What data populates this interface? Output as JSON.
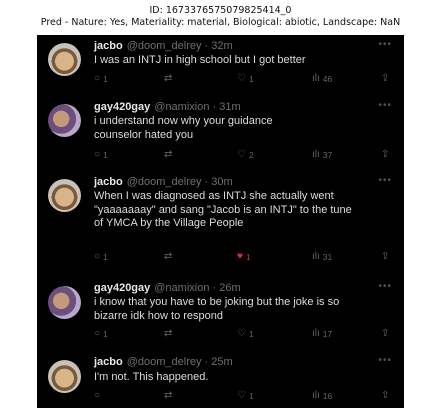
{
  "caption": {
    "line1": "ID: 1673376575079825414_0",
    "line2": "Pred - Nature: Yes, Materiality: material, Biological: abiotic, Landscape: NaN"
  },
  "tweets": [
    {
      "name": "jacbo",
      "handle": "@doom_delrey · 32m",
      "text": "I was an INTJ in high school but I got better",
      "reply": "1",
      "retweet": "",
      "like": "1",
      "views": "46"
    },
    {
      "name": "gay420gay",
      "handle": "@namixion · 31m",
      "text": "i understand now why your guidance counselor hated you",
      "reply": "1",
      "retweet": "",
      "like": "2",
      "views": "37"
    },
    {
      "name": "jacbo",
      "handle": "@doom_delrey · 30m",
      "text": "When I was diagnosed as INTJ she actually went \"yaaaaaaay\" and sang \"Jacob is an INTJ\" to the tune of YMCA by the Village People",
      "reply": "1",
      "retweet": "",
      "like": "1",
      "views": "31"
    },
    {
      "name": "gay420gay",
      "handle": "@namixion · 26m",
      "text": "i know that you have to be joking but the joke is so bizarre idk how to respond",
      "reply": "1",
      "retweet": "",
      "like": "1",
      "views": "17"
    },
    {
      "name": "jacbo",
      "handle": "@doom_delrey · 25m",
      "text": "I'm not. This happened.",
      "reply": "",
      "retweet": "",
      "like": "1",
      "views": "16"
    }
  ],
  "icons": {
    "reply": "reply-icon",
    "retweet": "retweet-icon",
    "like": "heart-icon",
    "views": "views-icon",
    "share": "share-icon",
    "more": "more-icon"
  },
  "colors": {
    "background": "#000000",
    "like_active": "#e0245e",
    "muted": "#6b6f73"
  }
}
